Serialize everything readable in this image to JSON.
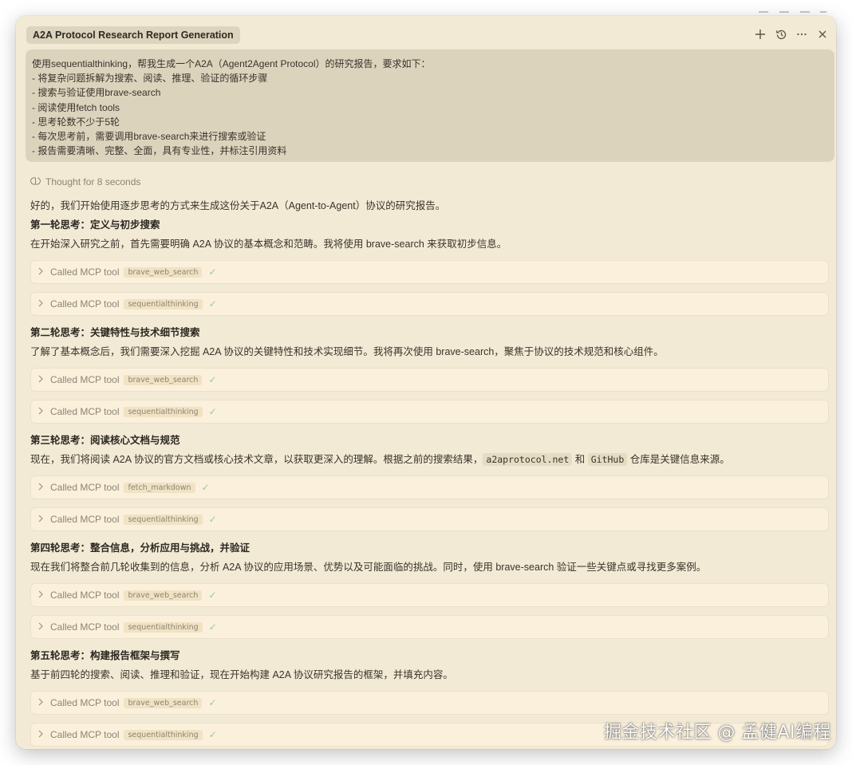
{
  "window": {
    "tab_title": "A2A Protocol Research Report Generation",
    "icons": [
      "plus-icon",
      "history-icon",
      "more-icon",
      "close-icon"
    ]
  },
  "prompt": {
    "lines": [
      "使用sequentialthinking，帮我生成一个A2A（Agent2Agent Protocol）的研究报告，要求如下：",
      "- 将复杂问题拆解为搜索、阅读、推理、验证的循环步骤",
      "- 搜索与验证使用brave-search",
      "- 阅读使用fetch tools",
      "- 思考轮数不少于5轮",
      "- 每次思考前，需要调用brave-search来进行搜索或验证",
      "- 报告需要清晰、完整、全面，具有专业性，并标注引用资料"
    ]
  },
  "thought_label": "Thought for 8 seconds",
  "intro": "好的，我们开始使用逐步思考的方式来生成这份关于A2A（Agent-to-Agent）协议的研究报告。",
  "tool_call_label": "Called MCP tool",
  "rounds": [
    {
      "title": "第一轮思考：定义与初步搜索",
      "text": "在开始深入研究之前，首先需要明确 A2A 协议的基本概念和范畴。我将使用 brave-search 来获取初步信息。",
      "tools": [
        "brave_web_search",
        "sequentialthinking"
      ]
    },
    {
      "title": "第二轮思考：关键特性与技术细节搜索",
      "text": "了解了基本概念后，我们需要深入挖掘 A2A 协议的关键特性和技术实现细节。我将再次使用 brave-search，聚焦于协议的技术规范和核心组件。",
      "tools": [
        "brave_web_search",
        "sequentialthinking"
      ]
    },
    {
      "title": "第三轮思考：阅读核心文档与规范",
      "text_before": "现在，我们将阅读 A2A 协议的官方文档或核心技术文章，以获取更深入的理解。根据之前的搜索结果，",
      "code1": "a2aprotocol.net",
      "text_mid": " 和 ",
      "code2": "GitHub",
      "text_after": " 仓库是关键信息来源。",
      "tools": [
        "fetch_markdown",
        "sequentialthinking"
      ]
    },
    {
      "title": "第四轮思考：整合信息，分析应用与挑战，并验证",
      "text": "现在我们将整合前几轮收集到的信息，分析 A2A 协议的应用场景、优势以及可能面临的挑战。同时，使用 brave-search 验证一些关键点或寻找更多案例。",
      "tools": [
        "brave_web_search",
        "sequentialthinking"
      ]
    },
    {
      "title": "第五轮思考：构建报告框架与撰写",
      "text": "基于前四轮的搜索、阅读、推理和验证，现在开始构建 A2A 协议研究报告的框架，并填充内容。",
      "tools": [
        "brave_web_search",
        "sequentialthinking"
      ]
    }
  ],
  "watermark": "掘金技术社区 @ 孟健AI编程"
}
